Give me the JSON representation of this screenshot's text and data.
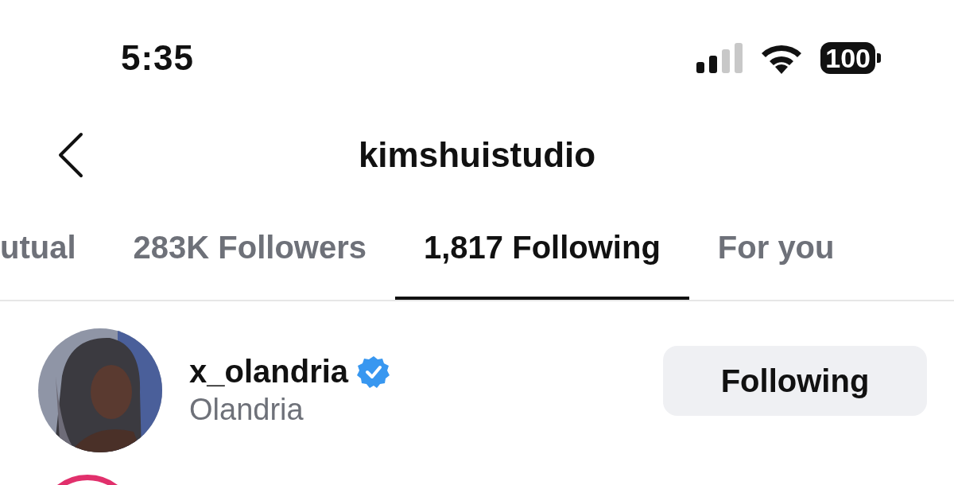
{
  "status_bar": {
    "time": "5:35",
    "battery": "100"
  },
  "header": {
    "title": "kimshuistudio"
  },
  "tabs": [
    {
      "label": "utual",
      "selected": false
    },
    {
      "label": "283K Followers",
      "selected": false
    },
    {
      "label": "1,817 Following",
      "selected": true
    },
    {
      "label": "For you",
      "selected": false
    }
  ],
  "accounts": [
    {
      "username": "x_olandria",
      "verified": true,
      "name": "Olandria",
      "button": "Following"
    }
  ]
}
